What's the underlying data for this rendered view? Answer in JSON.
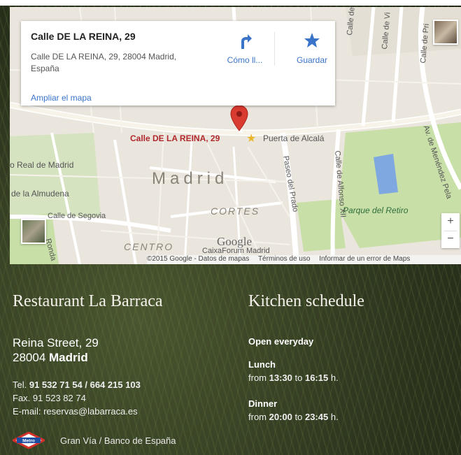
{
  "map": {
    "card": {
      "title": "Calle DE LA REINA, 29",
      "address": "Calle DE LA REINA, 29, 28004 Madrid, España",
      "enlarge_link": "Ampliar el mapa",
      "directions_label": "Cómo ll...",
      "save_label": "Guardar"
    },
    "labels": {
      "pin": "Calle DE LA REINA, 29",
      "puerta": "Puerta de Alcalá",
      "madrid": "Madrid",
      "real_madrid": "o Real de Madrid",
      "almudena": "de la Almudena",
      "segovia": "Calle de Segovia",
      "cortes": "CORTES",
      "centro": "CENTRO",
      "retiro": "Parque del Retiro",
      "caixa": "CaixaForum Madrid",
      "prado": "Paseo del Prado",
      "alfonso": "Calle de Alfonso XII",
      "menendez": "Av. de Menéndez Pela",
      "ronda": "Ronda",
      "street_s1": "Calle de S",
      "street_s2": "Calle de Vi",
      "street_s3": "Calle de Pri"
    },
    "google_logo": "Google",
    "attribution": {
      "copyright": "©2015 Google - Datos de mapas",
      "terms": "Términos de uso",
      "report": "Informar de un error de Maps"
    },
    "zoom_in": "+",
    "zoom_out": "−"
  },
  "restaurant": {
    "name": "Restaurant La Barraca",
    "address_line1": "Reina Street, 29",
    "postal": "28004",
    "city": "Madrid",
    "tel_label": "Tel.",
    "tel_numbers": "91 532 71 54 / 664 215 103",
    "fax_label": "Fax.",
    "fax_number": "91 523 82 74",
    "email_label": "E-mail:",
    "email": "reservas@labarraca.es",
    "metro_logo": "Metro",
    "metro_stations": "Gran Vía / Banco de España"
  },
  "schedule": {
    "title": "Kitchen schedule",
    "open": "Open everyday",
    "lunch_label": "Lunch",
    "lunch_from_word": "from",
    "lunch_from": "13:30",
    "lunch_to_word": "to",
    "lunch_to": "16:15",
    "lunch_suffix": "h.",
    "dinner_label": "Dinner",
    "dinner_from_word": "from",
    "dinner_from": "20:00",
    "dinner_to_word": "to",
    "dinner_to": "23:45",
    "dinner_suffix": "h."
  },
  "colors": {
    "link": "#3a74c9",
    "pin": "#d93b30",
    "park": "#c8dfa8",
    "water": "#7fa8e0"
  }
}
